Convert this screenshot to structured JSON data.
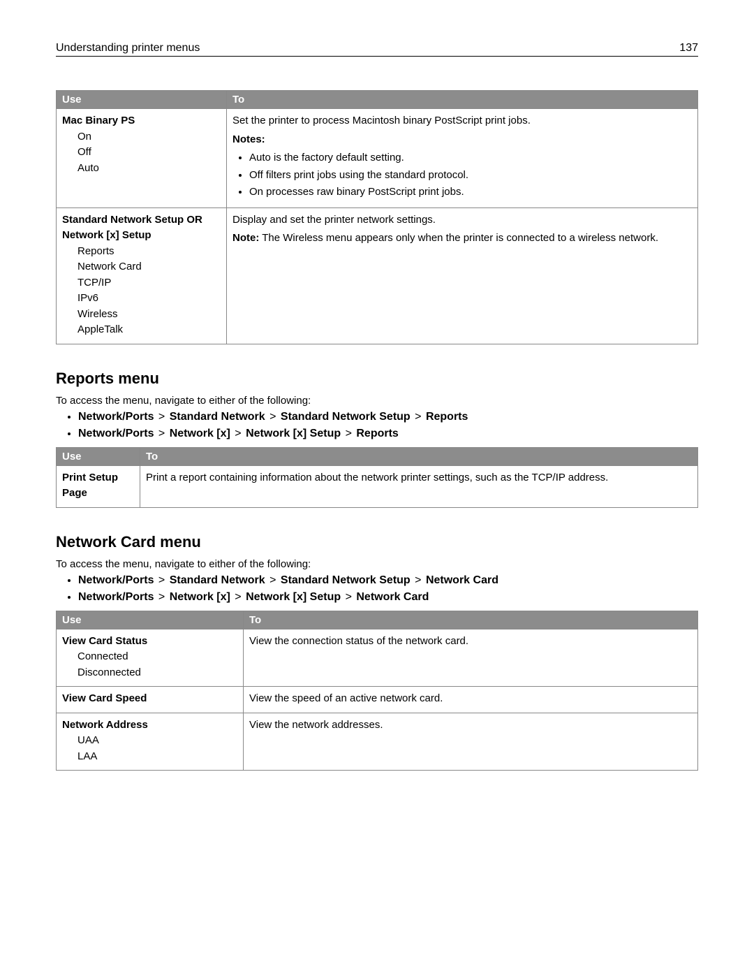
{
  "header": {
    "title": "Understanding printer menus",
    "page_number": "137"
  },
  "table1": {
    "headers": {
      "use": "Use",
      "to": "To"
    },
    "rows": [
      {
        "title": "Mac Binary PS",
        "options": [
          "On",
          "Off",
          "Auto"
        ],
        "desc": "Set the printer to process Macintosh binary PostScript print jobs.",
        "notes_label": "Notes:",
        "notes": [
          "Auto is the factory default setting.",
          "Off filters print jobs using the standard protocol.",
          "On processes raw binary PostScript print jobs."
        ]
      },
      {
        "title": "Standard Network Setup OR Network [x] Setup",
        "title_line1": "Standard Network Setup OR",
        "title_line2": "Network [x] Setup",
        "options": [
          "Reports",
          "Network Card",
          "TCP/IP",
          "IPv6",
          "Wireless",
          "AppleTalk"
        ],
        "desc": "Display and set the printer network settings.",
        "note_prefix": "Note:",
        "note_text": " The Wireless menu appears only when the printer is connected to a wireless network."
      }
    ]
  },
  "section_reports": {
    "heading": "Reports menu",
    "intro": "To access the menu, navigate to either of the following:",
    "paths": [
      [
        "Network/Ports",
        "Standard Network",
        "Standard Network Setup",
        "Reports"
      ],
      [
        "Network/Ports",
        "Network [x]",
        "Network [x] Setup",
        "Reports"
      ]
    ],
    "table": {
      "headers": {
        "use": "Use",
        "to": "To"
      },
      "rows": [
        {
          "use": "Print Setup Page",
          "to": "Print a report containing information about the network printer settings, such as the TCP/IP address."
        }
      ]
    }
  },
  "section_netcard": {
    "heading": "Network Card menu",
    "intro": "To access the menu, navigate to either of the following:",
    "paths": [
      [
        "Network/Ports",
        "Standard Network",
        "Standard Network Setup",
        "Network Card"
      ],
      [
        "Network/Ports",
        "Network [x]",
        "Network [x] Setup",
        "Network Card"
      ]
    ],
    "table": {
      "headers": {
        "use": "Use",
        "to": "To"
      },
      "rows": [
        {
          "title": "View Card Status",
          "options": [
            "Connected",
            "Disconnected"
          ],
          "to": "View the connection status of the network card."
        },
        {
          "title": "View Card Speed",
          "options": [],
          "to": "View the speed of an active network card."
        },
        {
          "title": "Network Address",
          "options": [
            "UAA",
            "LAA"
          ],
          "to": "View the network addresses."
        }
      ]
    }
  },
  "sep": ">"
}
